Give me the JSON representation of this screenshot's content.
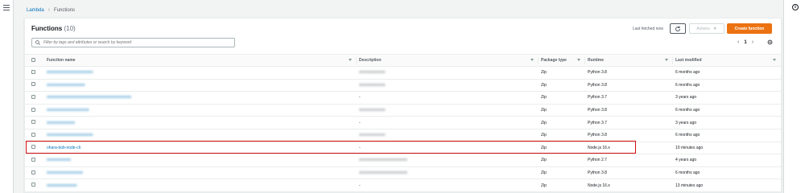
{
  "breadcrumb": {
    "parent": "Lambda",
    "current": "Functions"
  },
  "header": {
    "title": "Functions",
    "count": "(10)",
    "last_fetched": "Last fetched now",
    "actions_label": "Actions",
    "create_label": "Create function"
  },
  "search": {
    "placeholder": "Filter by tags and attributes or search by keyword"
  },
  "pagination": {
    "page": "1"
  },
  "columns": [
    "Function name",
    "Description",
    "Package type",
    "Runtime",
    "Last modified"
  ],
  "rows": [
    {
      "name": "xxxxxxxxxxxxxxxxxxxxxxx",
      "name_blurred": true,
      "description": "xxxxxxxxxxxxx",
      "desc_blurred": true,
      "package": "Zip",
      "runtime": "Python 3.8",
      "modified": "6 months ago"
    },
    {
      "name": "xxxxxxxxxxxxxxxxxxx",
      "name_blurred": true,
      "description": "xxxxxxxxxxxxx",
      "desc_blurred": true,
      "package": "Zip",
      "runtime": "Python 3.8",
      "modified": "6 months ago"
    },
    {
      "name": "xxxxxxxxxxxxxxxxxxxxxxxxxxxxxxxxxxxxxxxxxx",
      "name_blurred": true,
      "description": "-",
      "desc_blurred": false,
      "package": "Zip",
      "runtime": "Python 3.7",
      "modified": "3 years ago"
    },
    {
      "name": "xxxxxxxxxxxxxxxxxxxxx",
      "name_blurred": true,
      "description": "xxxxxxxxxxxxx",
      "desc_blurred": true,
      "package": "Zip",
      "runtime": "Python 3.8",
      "modified": "6 months ago"
    },
    {
      "name": "xxxxxxxxxxxxxx",
      "name_blurred": true,
      "description": "-",
      "desc_blurred": false,
      "package": "Zip",
      "runtime": "Python 3.7",
      "modified": "3 years ago"
    },
    {
      "name": "xxxxxxxxxxxxxxxxxxxxxxx",
      "name_blurred": true,
      "description": "xxxxxxxxxxxxx",
      "desc_blurred": true,
      "package": "Zip",
      "runtime": "Python 3.8",
      "modified": "6 months ago"
    },
    {
      "name": "ohara-bob-node-cli",
      "name_blurred": false,
      "description": "-",
      "desc_blurred": false,
      "package": "Zip",
      "runtime": "Node.js 16.x",
      "modified": "10 minutes ago"
    },
    {
      "name": "xxxxxxxxxxxx",
      "name_blurred": true,
      "description": "xxxxxxxxxxxxxxxxxxxxxxxx",
      "desc_blurred": true,
      "package": "Zip",
      "runtime": "Python 2.7",
      "modified": "4 years ago"
    },
    {
      "name": "xxxxxxxxxxxxxxxxxx",
      "name_blurred": true,
      "description": "xxxxxxxxxxxxxxxxxxxxxxxx",
      "desc_blurred": true,
      "package": "Zip",
      "runtime": "Python 3.8",
      "modified": "6 months ago"
    },
    {
      "name": "xxxxxxxxxxxxxxx",
      "name_blurred": true,
      "description": "-",
      "desc_blurred": false,
      "package": "Zip",
      "runtime": "Node.js 16.x",
      "modified": "13 minutes ago"
    }
  ],
  "colors": {
    "accent": "#ec7211",
    "link": "#0073bb",
    "highlight": "#d20f0f"
  }
}
